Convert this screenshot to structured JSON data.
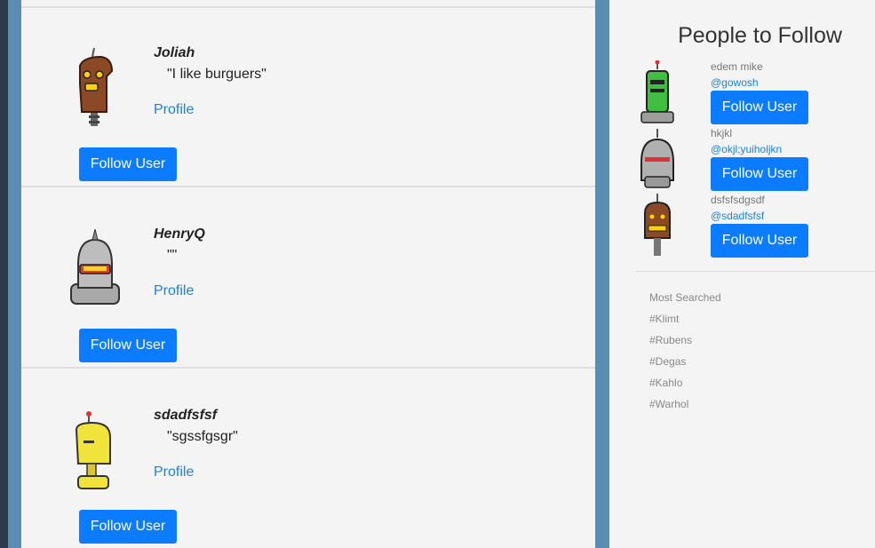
{
  "feed": {
    "posts": [
      {
        "author": "Joliah",
        "quote": "\"I like burguers\"",
        "profile_label": "Profile",
        "follow_label": "Follow User",
        "avatar": "brown-robot-icon"
      },
      {
        "author": "HenryQ",
        "quote": "\"\"",
        "profile_label": "Profile",
        "follow_label": "Follow User",
        "avatar": "silver-robot-icon"
      },
      {
        "author": "sdadfsfsf",
        "quote": "\"sgssfgsgr\"",
        "profile_label": "Profile",
        "follow_label": "Follow User",
        "avatar": "yellow-robot-icon"
      }
    ]
  },
  "sidebar": {
    "title": "People to Follow",
    "suggestions": [
      {
        "name": "edem mike",
        "handle": "@gowosh",
        "follow_label": "Follow User",
        "avatar": "green-robot-icon"
      },
      {
        "name": "hkjkl",
        "handle": "@okjl;yuiholjkn",
        "follow_label": "Follow User",
        "avatar": "grey-robot-icon"
      },
      {
        "name": "dsfsfsdgsdf",
        "handle": "@sdadfsfsf",
        "follow_label": "Follow User",
        "avatar": "brown-robot-icon"
      }
    ],
    "most_searched_label": "Most Searched",
    "tags": [
      "#Klimt",
      "#Rubens",
      "#Degas",
      "#Kahlo",
      "#Warhol"
    ]
  },
  "colors": {
    "accent": "#0b7bff",
    "link": "#1a82e2",
    "frame": "#5b8db0"
  }
}
